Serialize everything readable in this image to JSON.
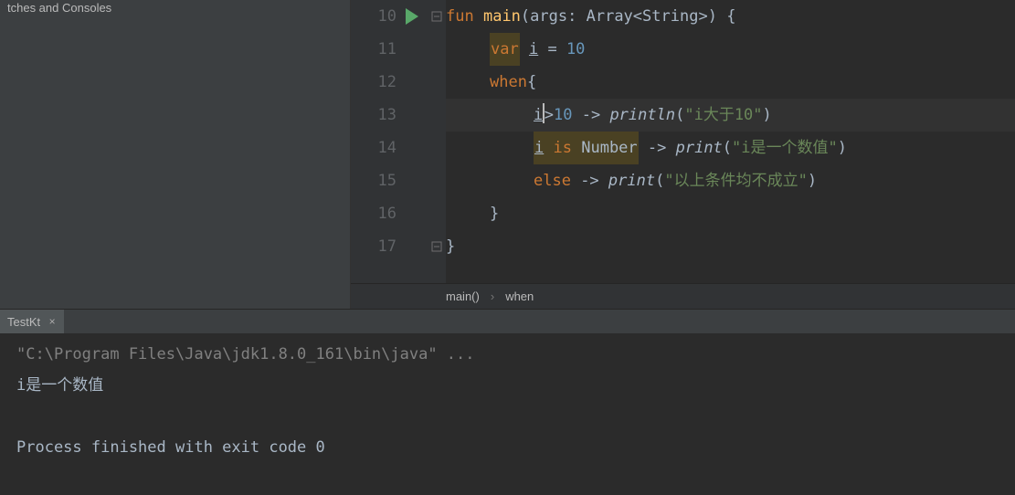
{
  "sidebar": {
    "title": "tches and Consoles"
  },
  "editor": {
    "line_numbers": [
      "10",
      "11",
      "12",
      "13",
      "14",
      "15",
      "16",
      "17"
    ],
    "lines": {
      "l10": {
        "fun": "fun",
        "main": "main",
        "lparen": "(",
        "args": "args",
        "colon": ": ",
        "array": "Array",
        "lt": "<",
        "string": "String",
        "gt": ">",
        "rparen": ")",
        "lbrace": " {"
      },
      "l11": {
        "var": "var",
        "sp": " ",
        "i": "i",
        "eq": " = ",
        "ten": "10"
      },
      "l12": {
        "when": "when",
        "lbrace": "{"
      },
      "l13": {
        "i": "i",
        "gt": ">",
        "ten": "10",
        "arr": " -> ",
        "println": "println",
        "lp": "(",
        "str": "\"i大于10\"",
        "rp": ")"
      },
      "l14": {
        "i": "i",
        "sp1": " ",
        "is": "is",
        "sp2": " ",
        "number": "Number",
        "arr": " -> ",
        "print": "print",
        "lp": "(",
        "str": "\"i是一个数值\"",
        "rp": ")"
      },
      "l15": {
        "else": "else",
        "arr": " -> ",
        "print": "print",
        "lp": "(",
        "str": "\"以上条件均不成立\"",
        "rp": ")"
      },
      "l16": {
        "rbrace": "}"
      },
      "l17": {
        "rbrace": "}"
      }
    }
  },
  "breadcrumb": {
    "main": "main()",
    "sep": "›",
    "when": "when"
  },
  "console": {
    "tab": "TestKt",
    "close": "×",
    "cmd": "\"C:\\Program Files\\Java\\jdk1.8.0_161\\bin\\java\" ...",
    "out1": "i是一个数值",
    "out2": "Process finished with exit code 0"
  }
}
